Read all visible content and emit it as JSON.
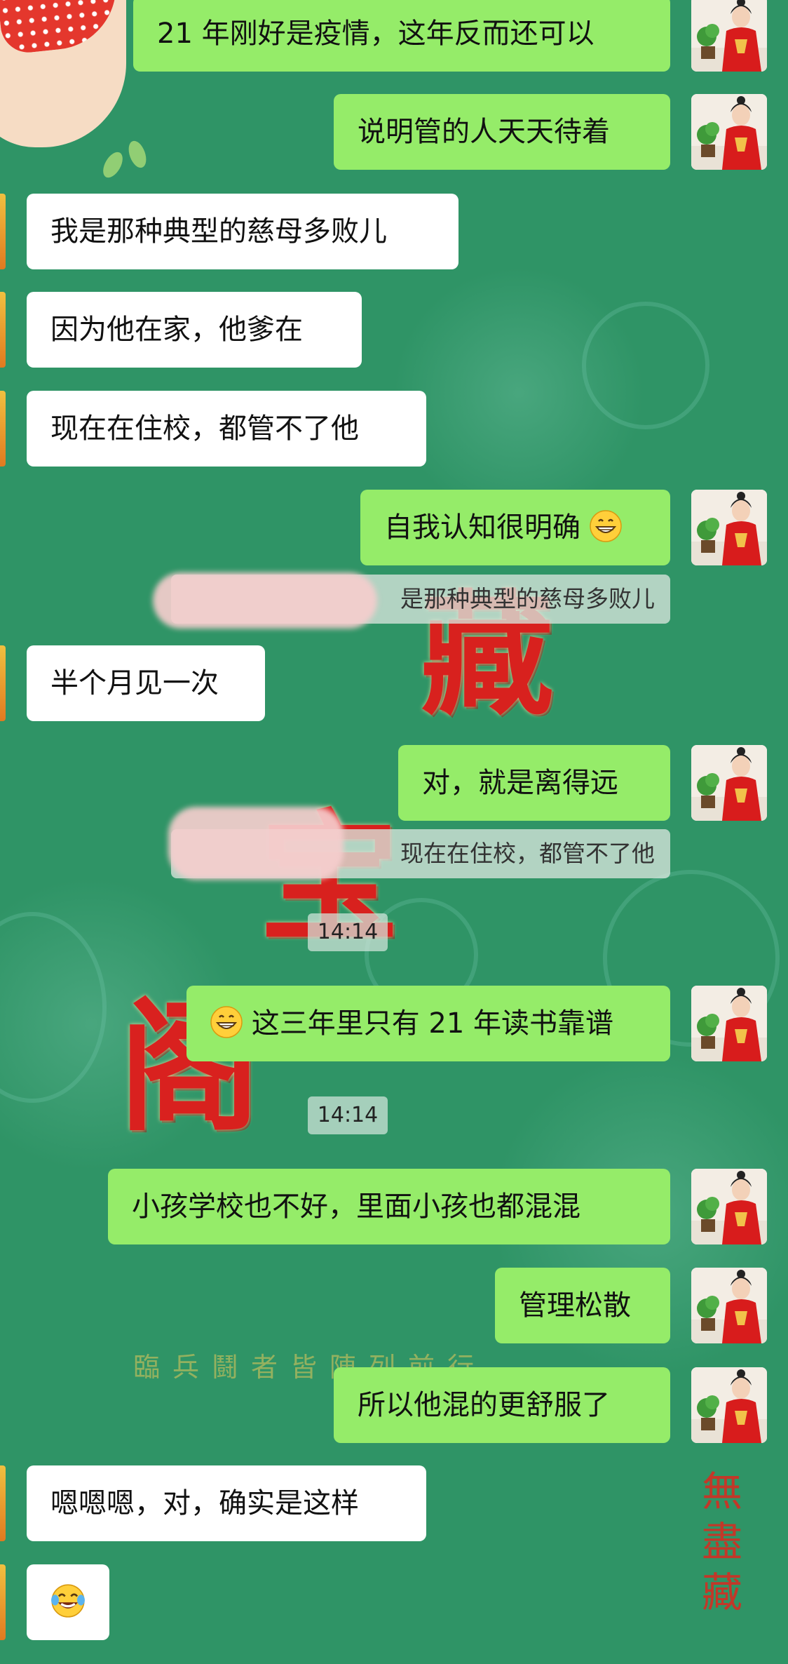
{
  "chat": {
    "messages": [
      {
        "side": "self",
        "text": "21 年刚好是疫情，这年反而还可以"
      },
      {
        "side": "self",
        "text": "说明管的人天天待着"
      },
      {
        "side": "other",
        "text": "我是那种典型的慈母多败儿"
      },
      {
        "side": "other",
        "text": "因为他在家，他爹在"
      },
      {
        "side": "other",
        "text": "现在在住校，都管不了他"
      },
      {
        "side": "self",
        "text": "自我认知很明确",
        "emoji_after": "grinning-face"
      },
      {
        "side": "other",
        "text": "半个月见一次"
      },
      {
        "side": "self",
        "text": "对，就是离得远"
      },
      {
        "side": "self",
        "text": "这三年里只有 21 年读书靠谱",
        "emoji_before": "grinning-face"
      },
      {
        "side": "self",
        "text": "小孩学校也不好，里面小孩也都混混"
      },
      {
        "side": "self",
        "text": "管理松散"
      },
      {
        "side": "self",
        "text": "所以他混的更舒服了"
      },
      {
        "side": "other",
        "text": "嗯嗯嗯，对，确实是这样"
      },
      {
        "side": "other",
        "text": "",
        "emoji_only": "tears-of-joy-face"
      }
    ],
    "quotes": [
      "是那种典型的慈母多败儿",
      "现在在住校，都管不了他"
    ],
    "timestamps": [
      "14:14",
      "14:14"
    ]
  },
  "wallpaper": {
    "calligraphy": [
      "藏",
      "宝",
      "阁"
    ],
    "motto": "臨兵鬪者皆陣列前行",
    "vertical_text": "無盡藏"
  },
  "colors": {
    "background": "#2f9466",
    "self_bubble": "#95ec69",
    "other_bubble": "#ffffff",
    "calligraphy_red": "#e21b1b"
  },
  "icons": {
    "self_avatar": "woman-in-red-hanfu-avatar",
    "reaction_emoji": "grinning-face",
    "laugh_emoji": "tears-of-joy-face"
  }
}
